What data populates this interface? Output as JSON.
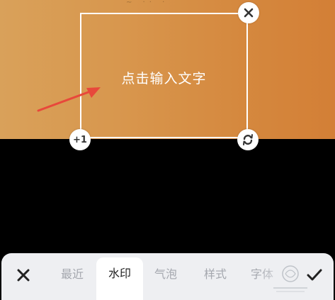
{
  "editor": {
    "text_placeholder": "点击输入文字",
    "copy_handle_label": "+1"
  },
  "toolbar": {
    "tabs": [
      {
        "label": "最近",
        "active": false
      },
      {
        "label": "水印",
        "active": true
      },
      {
        "label": "气泡",
        "active": false
      },
      {
        "label": "样式",
        "active": false
      },
      {
        "label": "字体",
        "active": false
      }
    ],
    "close_icon": "close-icon",
    "confirm_icon": "checkmark-icon"
  },
  "colors": {
    "toolbar_bg": "#eeeff2",
    "active_tab_bg": "#ffffff",
    "arrow": "#e8483b"
  }
}
